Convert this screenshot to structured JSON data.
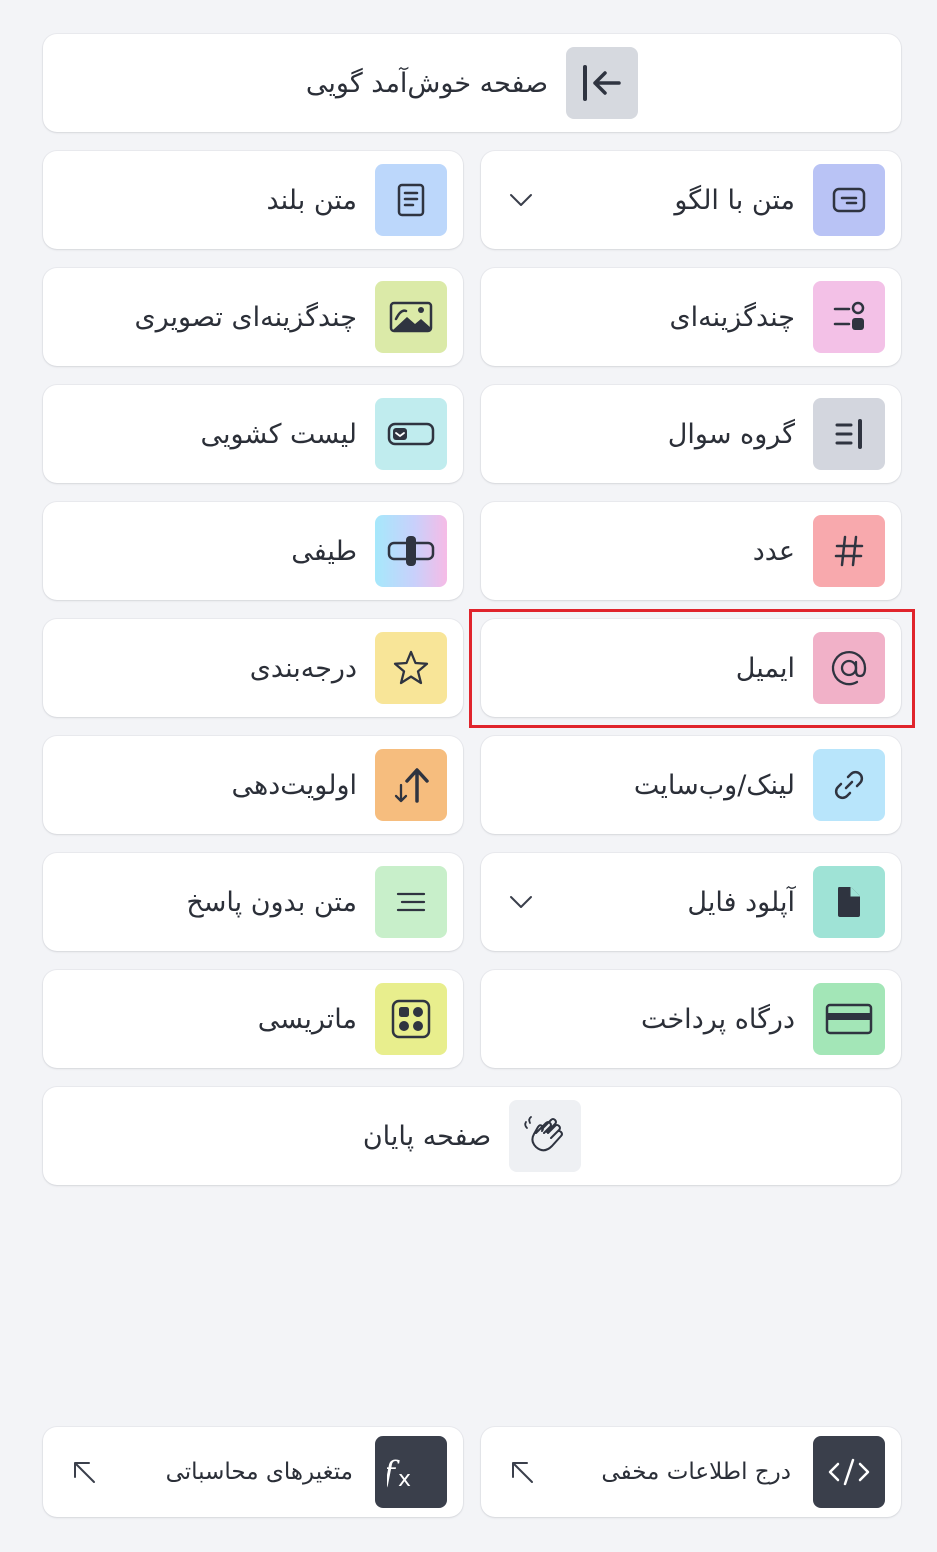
{
  "welcome": {
    "label": "صفحه خوش‌آمد گویی",
    "icon": "arrow-to-start-icon"
  },
  "items": [
    {
      "label": "متن با الگو",
      "icon": "pattern-text-icon",
      "bg": "#b9c3f5",
      "dropdown": true
    },
    {
      "label": "متن بلند",
      "icon": "long-text-icon",
      "bg": "#bcd7fb"
    },
    {
      "label": "چندگزینه‌ای",
      "icon": "multiple-choice-icon",
      "bg": "#f3c1e7"
    },
    {
      "label": "چندگزینه‌ای تصویری",
      "icon": "image-choice-icon",
      "bg": "#dbeaa8"
    },
    {
      "label": "گروه سوال",
      "icon": "question-group-icon",
      "bg": "#d3d6de"
    },
    {
      "label": "لیست کشویی",
      "icon": "dropdown-list-icon",
      "bg": "#c0ecee"
    },
    {
      "label": "عدد",
      "icon": "hash-icon",
      "bg": "#f8a9ad"
    },
    {
      "label": "طیفی",
      "icon": "range-slider-icon",
      "bg": "gradient"
    },
    {
      "label": "ایمیل",
      "icon": "at-sign-icon",
      "bg": "#f1b1c8"
    },
    {
      "label": "درجه‌بندی",
      "icon": "star-icon",
      "bg": "#f8e598"
    },
    {
      "label": "لینک/وب‌سایت",
      "icon": "link-icon",
      "bg": "#b8e5fb"
    },
    {
      "label": "اولویت‌دهی",
      "icon": "sort-arrows-icon",
      "bg": "#f6bd7e"
    },
    {
      "label": "آپلود فایل",
      "icon": "file-icon",
      "bg": "#9fe3d6",
      "dropdown": true
    },
    {
      "label": "متن بدون پاسخ",
      "icon": "statement-lines-icon",
      "bg": "#c8efca"
    },
    {
      "label": "درگاه پرداخت",
      "icon": "credit-card-icon",
      "bg": "#a3e6b7"
    },
    {
      "label": "ماتریسی",
      "icon": "matrix-grid-icon",
      "bg": "#e8ee8d"
    }
  ],
  "end": {
    "label": "صفحه پایان",
    "icon": "waving-hands-icon"
  },
  "bottom": [
    {
      "label": "درج اطلاعات مخفی",
      "icon": "code-icon"
    },
    {
      "label": "متغیرهای محاسباتی",
      "icon": "function-fx-icon"
    }
  ],
  "colors": {
    "highlight": "#e0242c",
    "page_bg": "#f3f4f7",
    "dark_icon_bg": "#3a3f4b"
  }
}
